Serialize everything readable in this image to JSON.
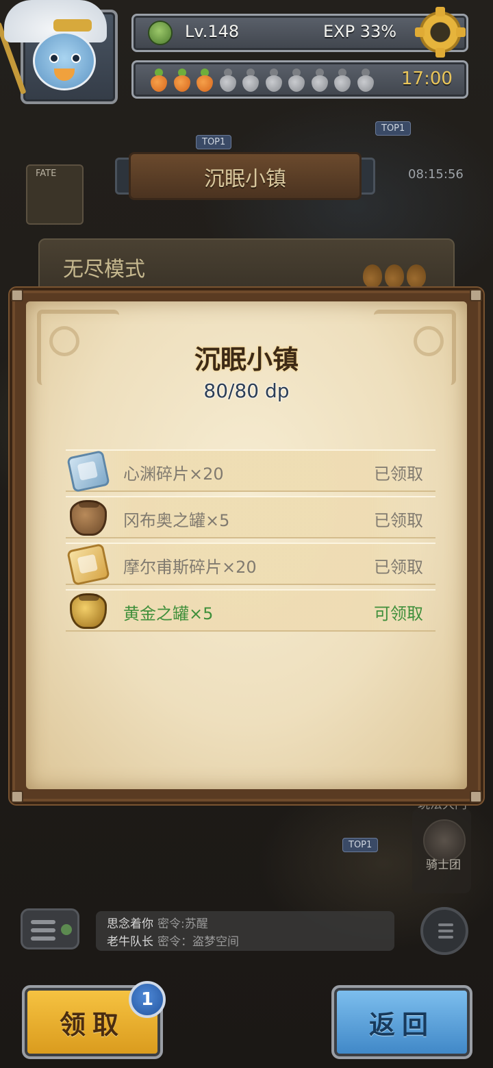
{
  "hud": {
    "level_label": "Lv.148",
    "exp_label": "EXP 33%",
    "stamina": {
      "filled": 3,
      "total": 10
    },
    "timer": "17:00"
  },
  "background": {
    "top1_label": "TOP1",
    "event_time": "08:15:56",
    "fate_label": "FATE",
    "map_banner_title": "沉眠小镇",
    "mode_title": "无尽模式",
    "play_portal_label": "玩法大门",
    "knights_label": "骑士团"
  },
  "chat": {
    "messages": [
      {
        "name": "思念着你",
        "text": "密令:苏醒"
      },
      {
        "name": "老牛队长",
        "text": "密令：盗梦空间"
      }
    ]
  },
  "modal": {
    "title": "沉眠小镇",
    "subtitle": "80/80 dp",
    "rewards": [
      {
        "icon": "blue-puzzle-icon",
        "name": "心渊碎片×20",
        "status": "已领取",
        "state": "claimed"
      },
      {
        "icon": "brown-jar-icon",
        "name": "冈布奥之罐×5",
        "status": "已领取",
        "state": "claimed"
      },
      {
        "icon": "gold-puzzle-icon",
        "name": "摩尔甫斯碎片×20",
        "status": "已领取",
        "state": "claimed"
      },
      {
        "icon": "gold-jar-icon",
        "name": "黄金之罐×5",
        "status": "可领取",
        "state": "claimable"
      }
    ]
  },
  "buttons": {
    "claim_label": "领取",
    "claim_badge": "1",
    "back_label": "返回"
  },
  "colors": {
    "claimed_text": "#807a6f",
    "claimable_text": "#3f8f3b",
    "claim_button": "#f0b431",
    "back_button": "#5ea6de"
  }
}
